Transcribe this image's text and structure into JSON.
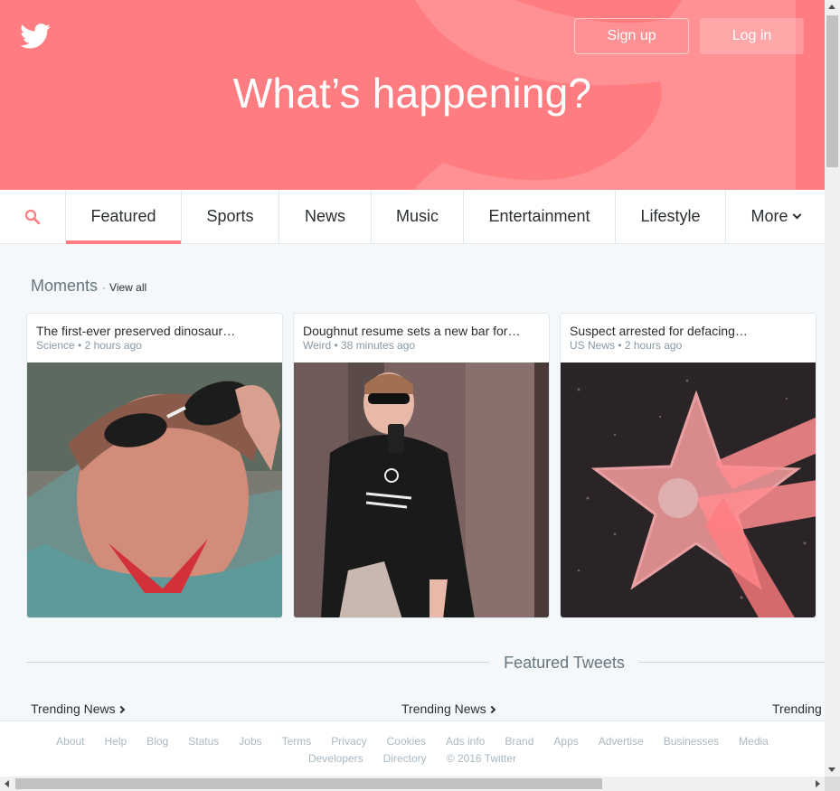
{
  "colors": {
    "brand": "#ff7c80",
    "accent_text": "#66757f"
  },
  "hero": {
    "title": "What’s happening?",
    "signup_label": "Sign up",
    "login_label": "Log in"
  },
  "nav": {
    "items": [
      "Featured",
      "Sports",
      "News",
      "Music",
      "Entertainment",
      "Lifestyle"
    ],
    "more_label": "More",
    "active": "Featured"
  },
  "moments": {
    "title": "Moments",
    "separator": "·",
    "view_all": "View all",
    "cards": [
      {
        "title": "The first-ever preserved dinosaur…",
        "category": "Science",
        "time": "2 hours ago",
        "meta": "Science • 2 hours ago"
      },
      {
        "title": "Doughnut resume sets a new bar for…",
        "category": "Weird",
        "time": "38 minutes ago",
        "meta": "Weird • 38 minutes ago"
      },
      {
        "title": "Suspect arrested for defacing…",
        "category": "US News",
        "time": "2 hours ago",
        "meta": "US News • 2 hours ago"
      }
    ]
  },
  "featured": {
    "title": "Featured Tweets",
    "trends": [
      "Trending News",
      "Trending News",
      "Trending N"
    ]
  },
  "footer": {
    "row1": [
      "About",
      "Help",
      "Blog",
      "Status",
      "Jobs",
      "Terms",
      "Privacy",
      "Cookies",
      "Ads info",
      "Brand",
      "Apps",
      "Advertise",
      "Businesses",
      "Media"
    ],
    "row2": [
      "Developers",
      "Directory",
      "© 2016 Twitter"
    ]
  }
}
